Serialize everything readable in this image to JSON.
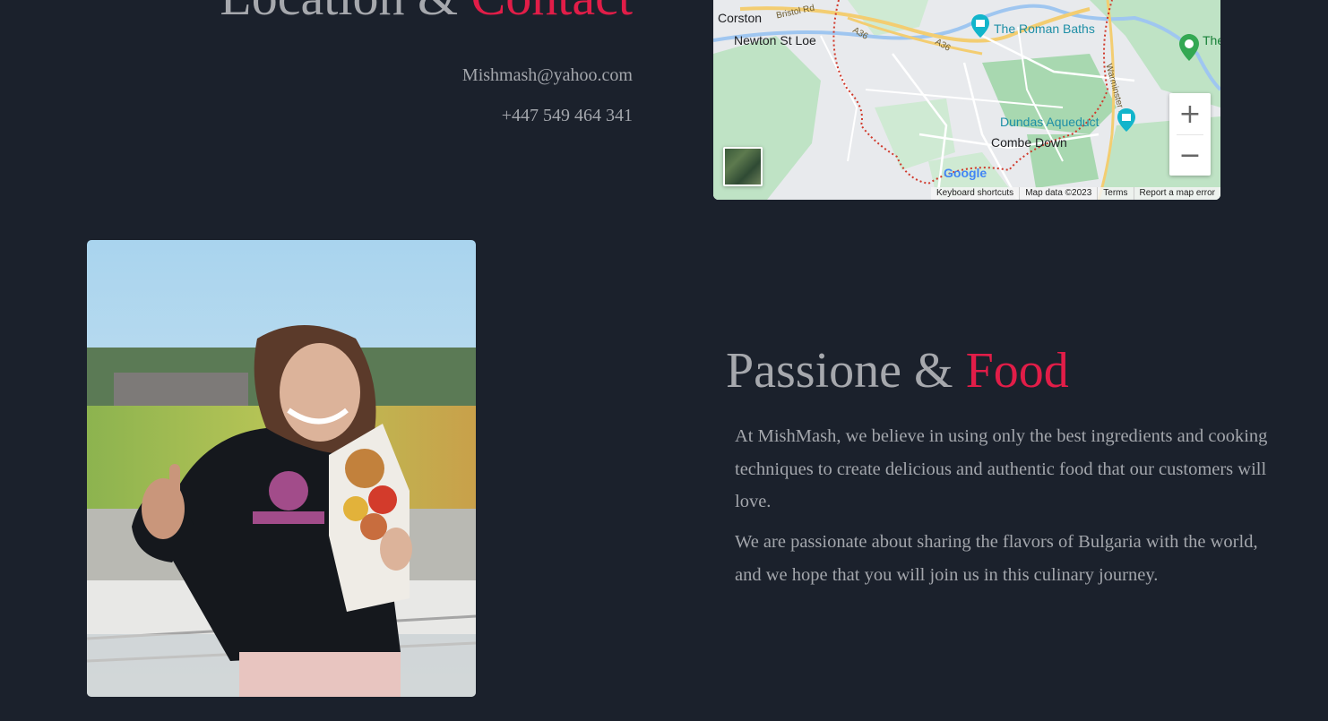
{
  "contact": {
    "heading_main": "Location & ",
    "heading_accent": "Contact",
    "email": "Mishmash@yahoo.com",
    "phone": "+447 549 464 341"
  },
  "map": {
    "places": {
      "corston": "Corston",
      "newton": "Newton St Loe",
      "roman_baths": "The Roman Baths",
      "dundas": "Dundas Aqueduct",
      "combe_down": "Combe Down",
      "partial_green": "The Wo"
    },
    "roads": {
      "bristol_rd": "Bristol Rd",
      "a36_1": "A36",
      "a36_2": "A36",
      "warminster": "Warminster Rd"
    },
    "zoom_in": "+",
    "zoom_out": "−",
    "logo": "Google",
    "attribution": {
      "shortcuts": "Keyboard shortcuts",
      "data": "Map data ©2023",
      "terms": "Terms",
      "report": "Report a map error"
    }
  },
  "about": {
    "heading_main": "Passione & ",
    "heading_accent": "Food",
    "paragraph_1": "At MishMash, we believe in using only the best ingredients and cooking techniques to create delicious and authentic food that our customers will love.",
    "paragraph_2": "We are passionate about sharing the flavors of Bulgaria with the world, and we hope that you will join us in this culinary journey."
  },
  "colors": {
    "background": "#1b212c",
    "accent": "#e11d48",
    "text": "#a3a6ac"
  }
}
